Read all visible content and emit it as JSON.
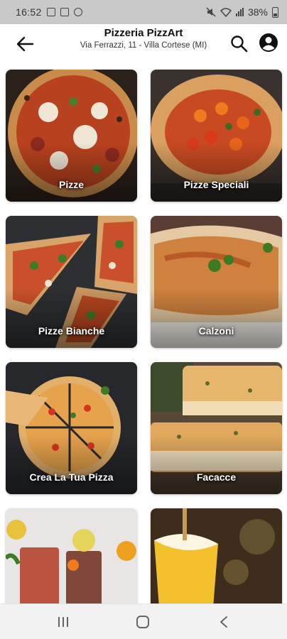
{
  "status_bar": {
    "time": "16:52",
    "battery": "38%"
  },
  "header": {
    "title": "Pizzeria PizzArt",
    "subtitle": "Via Ferrazzi, 11 - Villa Cortese (MI)",
    "icons": [
      "arrow-left-icon",
      "search-icon",
      "account-icon"
    ]
  },
  "categories": [
    {
      "label": "Pizze"
    },
    {
      "label": "Pizze Speciali"
    },
    {
      "label": "Pizze Bianche"
    },
    {
      "label": "Calzoni"
    },
    {
      "label": "Crea La Tua Pizza"
    },
    {
      "label": "Facacce"
    },
    {
      "label": ""
    },
    {
      "label": ""
    }
  ],
  "colors": {
    "status_bar_bg": "#c9c9c9",
    "header_bg": "#ffffff",
    "label_text": "#ffffff"
  }
}
